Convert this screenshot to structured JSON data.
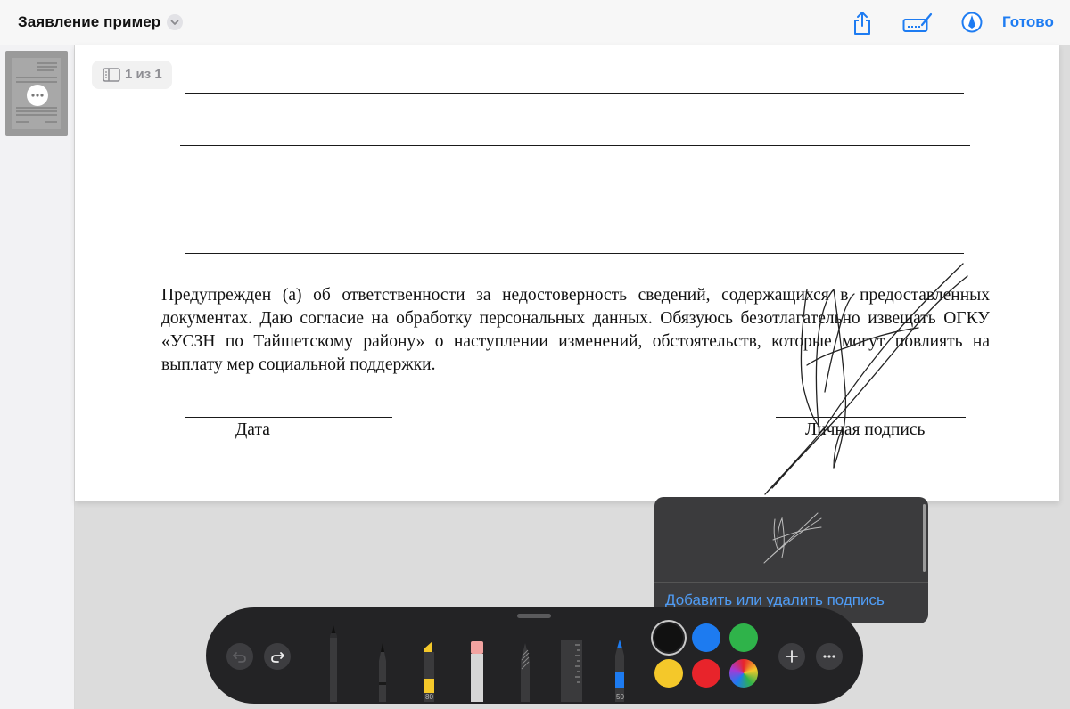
{
  "header": {
    "doc_title": "Заявление пример",
    "done_label": "Готово"
  },
  "page_indicator": "1 из 1",
  "document": {
    "notice": "Предупрежден (а) об ответственности за недостоверность сведений, содержащихся в предоставленных документах. Даю согласие на обработку персональных данных. Обязуюсь безотлагательно извещать ОГКУ «УСЗН по Тайшетскому району» о наступлении изменений, обстоятельств, которые могут повлиять на выплату мер социальной поддержки.",
    "date_label": "Дата",
    "signature_label": "Личная подпись"
  },
  "signature_menu": {
    "add_remove_label": "Добавить или удалить подпись"
  },
  "markup_toolbar": {
    "highlighter_value": "80",
    "pencil_value": "50",
    "colors": {
      "black": "#111111",
      "blue": "#1d7bf0",
      "green": "#2fb34a",
      "yellow": "#f4c82a",
      "red": "#e8242b"
    },
    "selected_color": "black"
  },
  "accent_color": "#1e7cf2",
  "icons": [
    "chevron-down-icon",
    "share-icon",
    "signature-icon",
    "markup-icon",
    "undo-icon",
    "redo-icon",
    "plus-icon",
    "more-icon",
    "page-icon"
  ]
}
